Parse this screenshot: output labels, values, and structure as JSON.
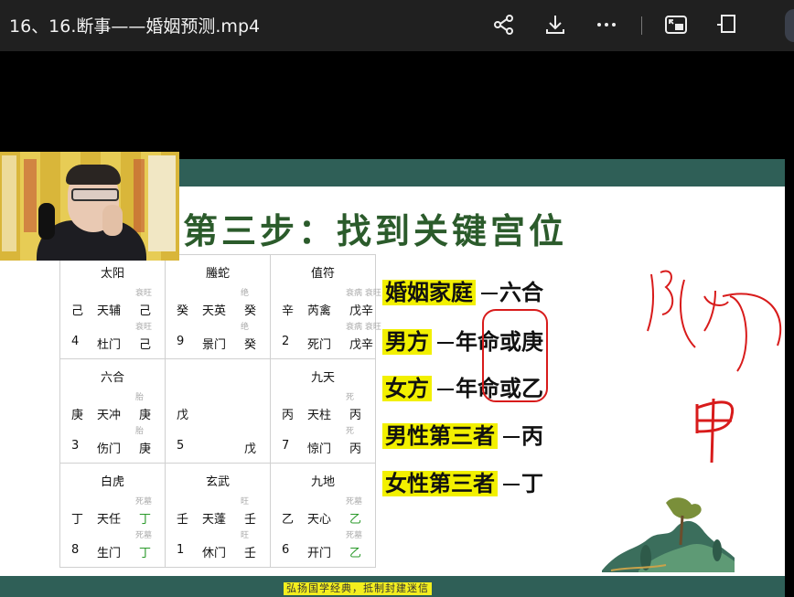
{
  "window": {
    "title": "16、16.断事——婚姻预测.mp4"
  },
  "toolbar": {
    "share_icon": "share-icon",
    "download_icon": "download-icon",
    "more_icon": "more-icon",
    "pip_icon": "picture-in-picture-icon",
    "fullscreen_icon": "fullscreen-icon"
  },
  "slide": {
    "title": "第三步：找到关键宫位",
    "footer": "弘扬国学经典，抵制封建迷信",
    "rules": [
      {
        "highlight": "婚姻家庭",
        "answer": "六合"
      },
      {
        "highlight": "男方",
        "answer": "年命或庚"
      },
      {
        "highlight": "女方",
        "answer": "年命或乙"
      },
      {
        "highlight": "男性第三者",
        "answer": "丙"
      },
      {
        "highlight": "女性第三者",
        "answer": "丁"
      }
    ],
    "palaces": [
      [
        {
          "god": "太阳",
          "r1": [
            "己",
            "天辅",
            "己"
          ],
          "r2": [
            "4",
            "杜门",
            "己"
          ],
          "s1": "衰旺",
          "s2": "衰旺"
        },
        {
          "god": "螣蛇",
          "r1": [
            "癸",
            "天英",
            "癸"
          ],
          "r2": [
            "9",
            "景门",
            "癸"
          ],
          "s1": "绝",
          "s2": "绝"
        },
        {
          "god": "值符",
          "r1": [
            "辛",
            "芮禽",
            "戊辛"
          ],
          "r2": [
            "2",
            "死门",
            "戊辛"
          ],
          "s1": "衰病 衰旺",
          "s2": "衰病 衰旺"
        }
      ],
      [
        {
          "god": "六合",
          "r1": [
            "庚",
            "天冲",
            "庚"
          ],
          "r2": [
            "3",
            "伤门",
            "庚"
          ],
          "s1": "胎",
          "s2": "胎"
        },
        {
          "god": "",
          "r1": [
            "戊",
            "",
            ""
          ],
          "r2": [
            "5",
            "",
            "戊"
          ],
          "s1": "",
          "s2": ""
        },
        {
          "god": "九天",
          "r1": [
            "丙",
            "天柱",
            "丙"
          ],
          "r2": [
            "7",
            "惊门",
            "丙"
          ],
          "s1": "死",
          "s2": "死"
        }
      ],
      [
        {
          "god": "白虎",
          "r1": [
            "丁",
            "天任",
            "丁"
          ],
          "r2": [
            "8",
            "生门",
            "丁"
          ],
          "s1": "死墓",
          "s2": "死墓"
        },
        {
          "god": "玄武",
          "r1": [
            "壬",
            "天蓬",
            "壬"
          ],
          "r2": [
            "1",
            "休门",
            "壬"
          ],
          "s1": "旺",
          "s2": "旺"
        },
        {
          "god": "九地",
          "r1": [
            "乙",
            "天心",
            "乙"
          ],
          "r2": [
            "6",
            "开门",
            "乙"
          ],
          "s1": "死墓",
          "s2": "死墓"
        }
      ]
    ],
    "handwriting": "15(45) 甲"
  },
  "colors": {
    "slide_band": "#2f5f57",
    "title_green": "#2b5b2b",
    "highlight": "#f2f000",
    "ink": "#d81b1b",
    "ganzhi_green": "#2a9a2a"
  }
}
